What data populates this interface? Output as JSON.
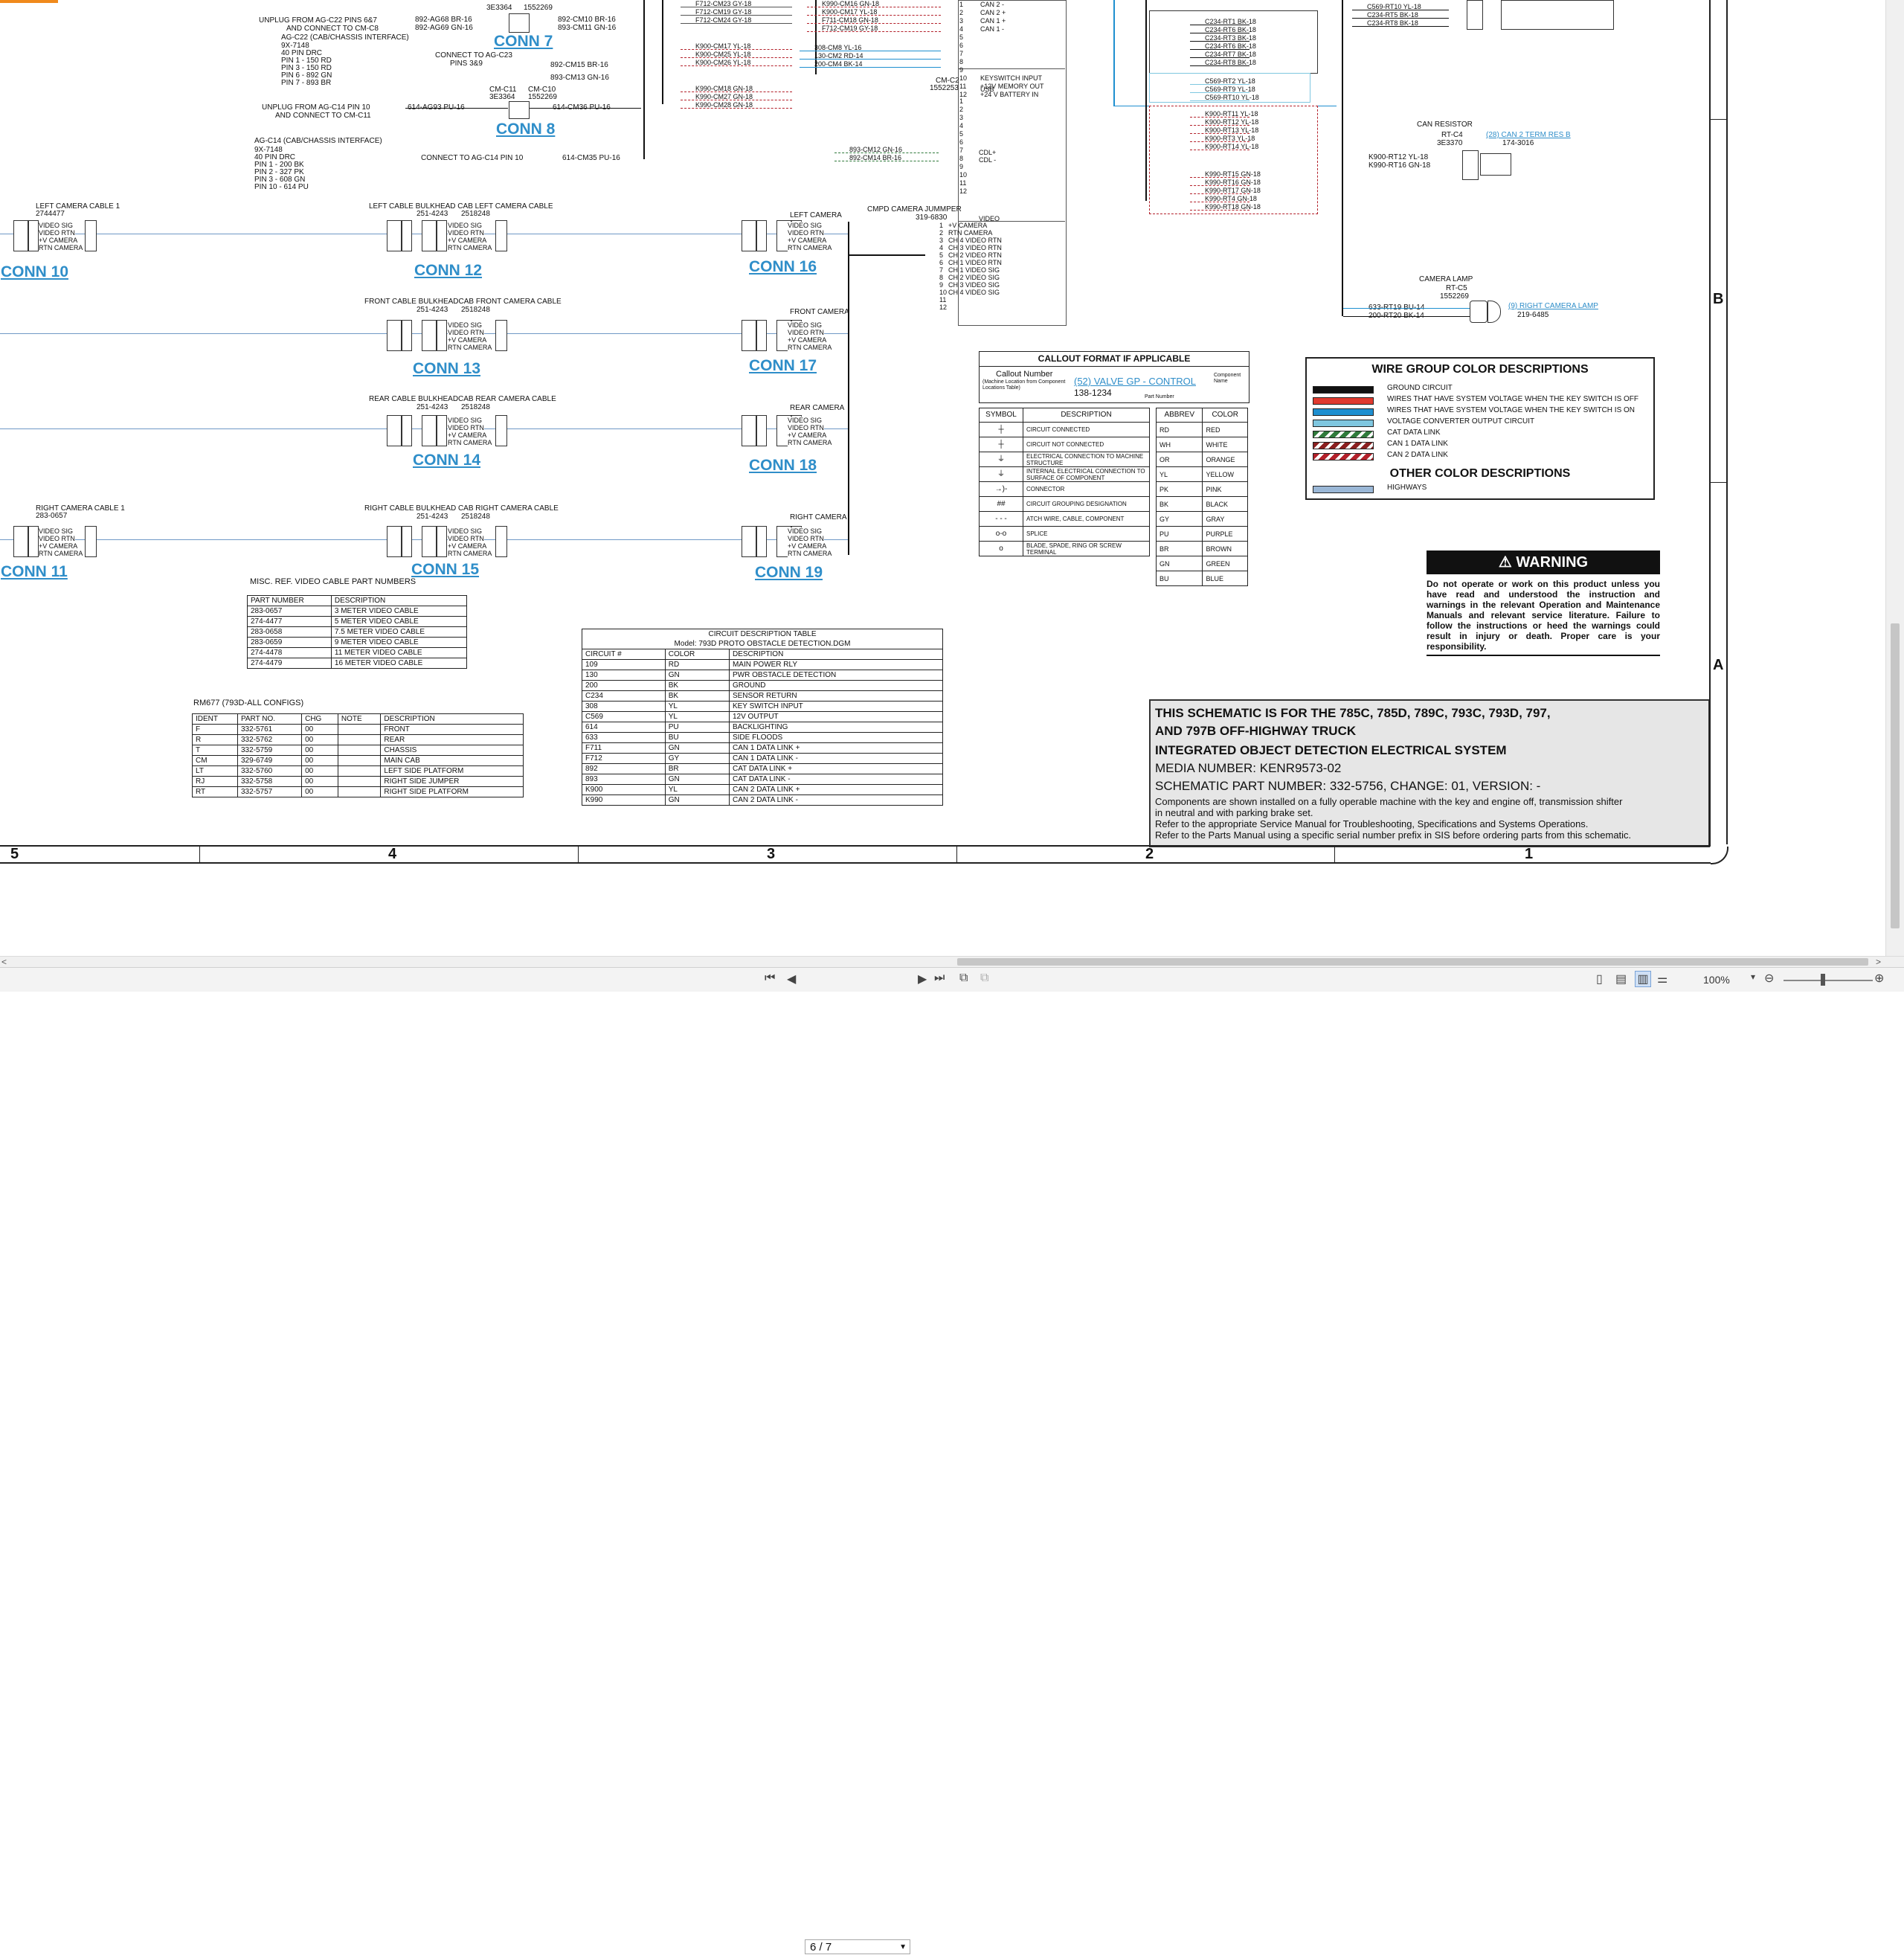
{
  "document": {
    "top_left": {
      "unplug1": "UNPLUG FROM AG-C22 PINS 6&7",
      "unplug1b": "AND CONNECT TO CM-C8",
      "agc22_title": "AG-C22 (CAB/CHASSIS INTERFACE)",
      "agc22_lines": [
        "9X-7148",
        "40 PIN DRC",
        "PIN 1 - 150 RD",
        "PIN 3 - 150 RD",
        "PIN 6 - 892 GN",
        "PIN 7 - 893 BR"
      ],
      "unplug2": "UNPLUG FROM AG-C14 PIN 10",
      "unplug2b": "AND CONNECT TO CM-C11",
      "agc14_title": "AG-C14 (CAB/CHASSIS INTERFACE)",
      "agc14_lines": [
        "9X-7148",
        "40 PIN DRC",
        "PIN 1 - 200 BK",
        "PIN 2 - 327 PK",
        "PIN 3 - 608 GN",
        "PIN 10 - 614 PU"
      ],
      "connect_c23": "CONNECT TO AG-C23",
      "connect_c23b": "PINS 3&9",
      "connect_c14": "CONNECT TO AG-C14 PIN 10",
      "w1": "892-AG68 BR-16",
      "w2": "892-AG69 GN-16",
      "w3": "892-CM10 BR-16",
      "w4": "893-CM11 GN-16",
      "w5": "892-CM15 BR-16",
      "w6": "893-CM13 GN-16",
      "w7": "614-AG93 PU-16",
      "w8": "614-CM36 PU-16",
      "w9": "614-CM35 PU-16",
      "p1": "3E3364",
      "p2": "1552269",
      "p3": "CM-C11",
      "p4": "CM-C10",
      "p5": "3E3364",
      "p6": "1552269"
    },
    "conns": {
      "c7": "CONN 7",
      "c8": "CONN 8",
      "c10": "CONN 10",
      "c11": "CONN 11",
      "c12": "CONN 12",
      "c13": "CONN 13",
      "c14": "CONN 14",
      "c15": "CONN 15",
      "c16": "CONN 16",
      "c17": "CONN 17",
      "c18": "CONN 18",
      "c19": "CONN 19"
    },
    "cables": {
      "lcc1": "LEFT CAMERA CABLE 1",
      "lcc1_pn": "2744477",
      "rcc1": "RIGHT CAMERA CABLE 1",
      "rcc1_pn": "283-0657",
      "lbh": "LEFT CABLE BULKHEAD CAB LEFT CAMERA CABLE",
      "fbh": "FRONT CABLE BULKHEADCAB FRONT CAMERA CABLE",
      "rbh": "REAR CABLE BULKHEADCAB REAR CAMERA CABLE",
      "rtbh": "RIGHT CABLE BULKHEAD CAB RIGHT CAMERA CABLE",
      "pn_a": "251-4243",
      "pn_b": "2518248",
      "left_cam": "LEFT CAMERA",
      "front_cam": "FRONT CAMERA",
      "rear_cam": "REAR CAMERA",
      "right_cam": "RIGHT CAMERA",
      "sig": [
        "VIDEO SIG",
        "VIDEO RTN",
        "+V CAMERA",
        "RTN CAMERA"
      ]
    },
    "mid_top": {
      "wires_a": [
        "F712-CM23 GY-18",
        "F712-CM19 GY-18",
        "F712-CM24 GY-18"
      ],
      "wires_b": [
        "K900-CM17 YL-18",
        "K900-CM25 YL-18",
        "K900-CM26 YL-18"
      ],
      "wires_c": [
        "K990-CM18 GN-18",
        "K990-CM27 GN-18",
        "K990-CM28 GN-18"
      ],
      "wires_d": [
        "K990-CM16 GN-18",
        "K900-CM17 YL-18",
        "F711-CM18 GN-18",
        "F712-CM19 GY-18"
      ],
      "wires_e": [
        "308-CM8 YL-16",
        "130-CM2 RD-14",
        "200-CM4 BK-14"
      ],
      "wires_f": [
        "893-CM12 GN-16",
        "892-CM14 BR-16"
      ],
      "cmc2": "CM-C2",
      "cmc2_pn": "1552253",
      "pins_top": [
        "CAN 2 -",
        "CAN 2 +",
        "CAN 1 +",
        "CAN 1 -",
        "",
        "",
        "",
        "",
        "",
        "KEYSWITCH INPUT",
        "+12V MEMORY OUT",
        "+24 V BATTERY IN"
      ],
      "usb": "USB",
      "cdl_p": "CDL+",
      "cdl_m": "CDL -",
      "video": "VIDEO",
      "cmpd": "CMPD CAMERA JUMMPER",
      "cmpd_pn": "319-6830",
      "cam_pins": [
        "+V CAMERA",
        "RTN CAMERA",
        "CH 4 VIDEO RTN",
        "CH 3 VIDEO RTN",
        "CH 2 VIDEO RTN",
        "CH 1 VIDEO RTN",
        "CH 1 VIDEO SIG",
        "CH 2 VIDEO SIG",
        "CH 3 VIDEO SIG",
        "CH 4 VIDEO SIG"
      ]
    },
    "right_top": {
      "wires_rt1": [
        "C234-RT1 BK-18",
        "C234-RT6 BK-18",
        "C234-RT3 BK-18",
        "C234-RT6 BK-18",
        "C234-RT7 BK-18",
        "C234-RT8 BK-18"
      ],
      "wires_rt2": [
        "C569-RT2 YL-18",
        "C569-RT9 YL-18",
        "C569-RT10 YL-18"
      ],
      "wires_rt3": [
        "K900-RT11 YL-18",
        "K900-RT12 YL-18",
        "K900-RT13 YL-18",
        "K900-RT3 YL-18",
        "K900-RT14 YL-18"
      ],
      "wires_rt4": [
        "K990-RT15 GN-18",
        "K990-RT16 GN-18",
        "K990-RT17 GN-18",
        "K990-RT4 GN-18",
        "K990-RT18 GN-18"
      ],
      "wires_rt5": [
        "C569-RT10 YL-18",
        "C234-RT5 BK-18",
        "C234-RT8 BK-18"
      ],
      "pins_rt5": [
        "+12V",
        "MRIO 1",
        "MRIO 0"
      ],
      "can_res": "CAN RESISTOR",
      "rt_c4": "RT-C4",
      "rt_c4_pn": "3E3370",
      "can_res_link": "(28) CAN 2 TERM RES B",
      "can_res_pn": "174-3016",
      "res_wires": [
        "K900-RT12 YL-18",
        "K990-RT16 GN-18"
      ],
      "cam_lamp": "CAMERA LAMP",
      "rt_c5": "RT-C5",
      "rt_c5_pn": "1552269",
      "lamp_wires": [
        "633-RT19 BU-14",
        "200-RT20 BK-14"
      ],
      "lamp_link": "(9) RIGHT CAMERA LAMP",
      "lamp_pn": "219-6485"
    },
    "callout": {
      "title": "CALLOUT FORMAT IF APPLICABLE",
      "cn": "Callout Number",
      "cn_sub": "(Machine Location from Component Locations Table)",
      "link": "(52) VALVE GP - CONTROL",
      "comp": "Component Name",
      "pn": "138-1234",
      "pn_lbl": "Part Number"
    },
    "symbols": {
      "head": [
        "SYMBOL",
        "DESCRIPTION"
      ],
      "rows": [
        "CIRCUIT CONNECTED",
        "CIRCUIT NOT CONNECTED",
        "ELECTRICAL CONNECTION TO MACHINE STRUCTURE",
        "INTERNAL ELECTRICAL CONNECTION TO SURFACE OF COMPONENT",
        "CONNECTOR",
        "CIRCUIT GROUPING DESIGNATION",
        "ATCH WIRE, CABLE, COMPONENT",
        "SPLICE",
        "BLADE, SPADE, RING OR SCREW TERMINAL"
      ],
      "glyphs": [
        "┼",
        "┼",
        "⏚",
        "⏚",
        "→)-",
        "##",
        "- - -",
        "o-o",
        "o"
      ]
    },
    "abbrev": {
      "head": [
        "ABBREV",
        "COLOR"
      ],
      "rows": [
        [
          "RD",
          "RED"
        ],
        [
          "WH",
          "WHITE"
        ],
        [
          "OR",
          "ORANGE"
        ],
        [
          "YL",
          "YELLOW"
        ],
        [
          "PK",
          "PINK"
        ],
        [
          "BK",
          "BLACK"
        ],
        [
          "GY",
          "GRAY"
        ],
        [
          "PU",
          "PURPLE"
        ],
        [
          "BR",
          "BROWN"
        ],
        [
          "GN",
          "GREEN"
        ],
        [
          "BU",
          "BLUE"
        ]
      ]
    },
    "wire_groups": {
      "title": "WIRE GROUP COLOR DESCRIPTIONS",
      "rows": [
        {
          "label": "GROUND CIRCUIT",
          "color": "#111111"
        },
        {
          "label": "WIRES THAT HAVE SYSTEM VOLTAGE WHEN THE KEY SWITCH IS OFF",
          "color": "#e03a2f"
        },
        {
          "label": "WIRES THAT HAVE SYSTEM VOLTAGE WHEN THE KEY SWITCH IS ON",
          "color": "#1e8fd0"
        },
        {
          "label": "VOLTAGE CONVERTER OUTPUT CIRCUIT",
          "color": "#7fc7e0"
        },
        {
          "label": "CAT DATA LINK",
          "color": "#2f7a3b"
        },
        {
          "label": "CAN 1 DATA LINK",
          "color": "#8a1f1f"
        },
        {
          "label": "CAN 2 DATA LINK",
          "color": "#b3202a"
        }
      ],
      "other_title": "OTHER COLOR DESCRIPTIONS",
      "other_rows": [
        {
          "label": "HIGHWAYS",
          "color": "#9ab7d6"
        }
      ]
    },
    "warning": {
      "title": "WARNING",
      "text": "Do not operate or work on this product unless you have read and understood the instruction and warnings in the relevant Operation and Maintenance Manuals and relevant service literature. Failure to follow the instructions or heed the warnings could result in injury or death. Proper care is your responsibility."
    },
    "misc_ref": {
      "title": "MISC. REF. VIDEO CABLE PART NUMBERS",
      "head": [
        "PART NUMBER",
        "DESCRIPTION"
      ],
      "rows": [
        [
          "283-0657",
          "3 METER VIDEO CABLE"
        ],
        [
          "274-4477",
          "5 METER VIDEO CABLE"
        ],
        [
          "283-0658",
          "7.5 METER VIDEO CABLE"
        ],
        [
          "283-0659",
          "9 METER VIDEO CABLE"
        ],
        [
          "274-4478",
          "11 METER VIDEO CABLE"
        ],
        [
          "274-4479",
          "16 METER VIDEO CABLE"
        ]
      ]
    },
    "rm677": {
      "title": "RM677 (793D-ALL CONFIGS)",
      "head": [
        "IDENT",
        "PART NO.",
        "CHG",
        "NOTE",
        "DESCRIPTION"
      ],
      "rows": [
        [
          "F",
          "332-5761",
          "00",
          "",
          "FRONT"
        ],
        [
          "R",
          "332-5762",
          "00",
          "",
          "REAR"
        ],
        [
          "T",
          "332-5759",
          "00",
          "",
          "CHASSIS"
        ],
        [
          "CM",
          "329-6749",
          "00",
          "",
          "MAIN CAB"
        ],
        [
          "LT",
          "332-5760",
          "00",
          "",
          "LEFT SIDE PLATFORM"
        ],
        [
          "RJ",
          "332-5758",
          "00",
          "",
          "RIGHT SIDE JUMPER"
        ],
        [
          "RT",
          "332-5757",
          "00",
          "",
          "RIGHT SIDE PLATFORM"
        ]
      ]
    },
    "circuit_table": {
      "title": "CIRCUIT DESCRIPTION TABLE",
      "subtitle": "Model: 793D PROTO OBSTACLE DETECTION.DGM",
      "head": [
        "CIRCUIT #",
        "COLOR",
        "DESCRIPTION"
      ],
      "rows": [
        [
          "109",
          "RD",
          "MAIN POWER RLY"
        ],
        [
          "130",
          "GN",
          "PWR OBSTACLE DETECTION"
        ],
        [
          "200",
          "BK",
          "GROUND"
        ],
        [
          "C234",
          "BK",
          "SENSOR RETURN"
        ],
        [
          "308",
          "YL",
          "KEY SWITCH INPUT"
        ],
        [
          "C569",
          "YL",
          "12V OUTPUT"
        ],
        [
          "614",
          "PU",
          "BACKLIGHTING"
        ],
        [
          "633",
          "BU",
          "SIDE FLOODS"
        ],
        [
          "F711",
          "GN",
          "CAN 1 DATA LINK +"
        ],
        [
          "F712",
          "GY",
          "CAN 1 DATA LINK -"
        ],
        [
          "892",
          "BR",
          "CAT DATA LINK +"
        ],
        [
          "893",
          "GN",
          "CAT DATA LINK -"
        ],
        [
          "K900",
          "YL",
          "CAN 2 DATA LINK +"
        ],
        [
          "K990",
          "GN",
          "CAN 2 DATA LINK -"
        ]
      ]
    },
    "title_block": {
      "l1": "THIS SCHEMATIC IS FOR THE 785C, 785D, 789C, 793C, 793D, 797,",
      "l2": "AND 797B OFF-HIGHWAY TRUCK",
      "l3": "INTEGRATED OBJECT DETECTION ELECTRICAL SYSTEM",
      "l4": "MEDIA NUMBER: KENR9573-02",
      "l5": "SCHEMATIC PART NUMBER: 332-5756, CHANGE: 01, VERSION: -",
      "l6": "Components are shown installed on a fully operable machine with the key and engine off, transmission shifter",
      "l7": "in neutral and with parking brake set.",
      "l8": "Refer to the appropriate Service Manual for Troubleshooting, Specifications and Systems Operations.",
      "l9": "Refer to the Parts Manual using a specific serial number prefix in SIS before ordering parts from this schematic."
    },
    "zones": {
      "cols": [
        "5",
        "4",
        "3",
        "2",
        "1"
      ],
      "rows": [
        "B",
        "A"
      ]
    }
  },
  "viewer": {
    "page_value": "6 / 7",
    "zoom": "100%",
    "scroll_left": "<",
    "scroll_right": ">"
  }
}
